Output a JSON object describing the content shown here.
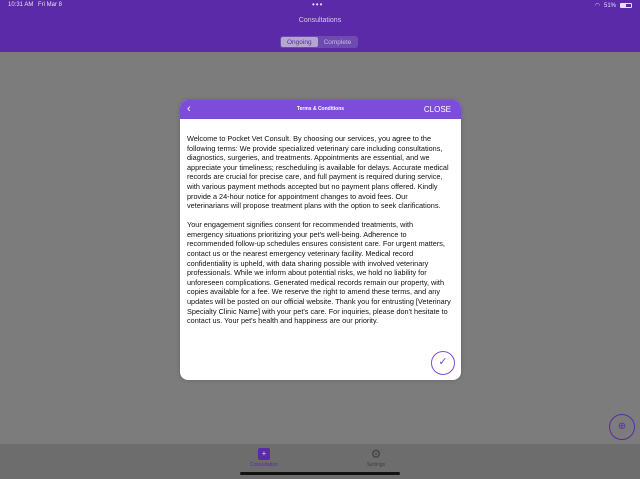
{
  "status_bar": {
    "time": "10:31 AM",
    "date": "Fri Mar 8",
    "dots": "•••",
    "battery": "51%"
  },
  "header": {
    "title": "Consultations",
    "tabs": [
      "Ongoing",
      "Complete"
    ]
  },
  "modal": {
    "title": "Terms & Conditions",
    "close_label": "CLOSE",
    "back_icon": "‹",
    "paragraphs": [
      "Welcome to Pocket Vet Consult. By choosing our services, you agree to the following terms: We provide specialized veterinary care including consultations, diagnostics, surgeries, and treatments. Appointments are essential, and we appreciate your timeliness; rescheduling is available for delays. Accurate medical records are crucial for precise care, and full payment is required during service, with various payment methods accepted but no payment plans offered. Kindly provide a 24-hour notice for appointment changes to avoid fees. Our veterinarians will propose treatment plans with the option to seek clarifications.",
      "Your engagement signifies consent for recommended treatments, with emergency situations prioritizing your pet's well-being. Adherence to recommended follow-up schedules ensures consistent care. For urgent matters, contact us or the nearest emergency veterinary facility. Medical record confidentiality is upheld, with data sharing possible with involved veterinary professionals. While we inform about potential risks, we hold no liability for unforeseen complications. Generated medical records remain our property, with copies available for a fee. We reserve the right to amend these terms, and any updates will be posted on our official website. Thank you for entrusting [Veterinary Specialty Clinic Name] with your pet's care. For inquiries, please don't hesitate to contact us. Your pet's health and happiness are our priority."
    ],
    "confirm_icon": "✓"
  },
  "tabbar": {
    "consultation": "Consultation",
    "settings": "Settings"
  },
  "icons": {
    "consult": "+",
    "settings": "⚙",
    "fab": "⊕"
  },
  "colors": {
    "primary": "#5b2aa8",
    "accent": "#7c4ddb"
  }
}
